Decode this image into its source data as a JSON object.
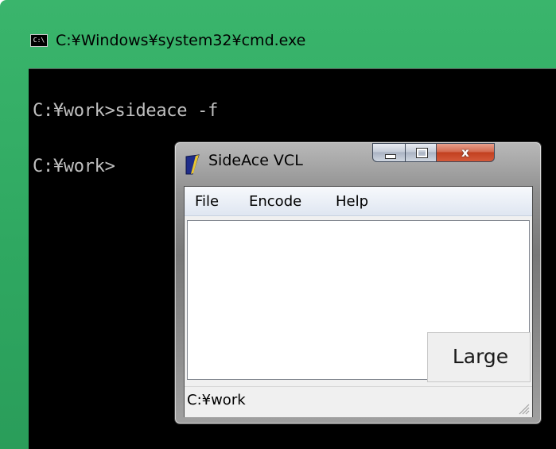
{
  "cmd": {
    "icon_text": "C:\\",
    "title": "C:¥Windows¥system32¥cmd.exe",
    "lines": [
      "C:¥work>sideace -f",
      "C:¥work>"
    ]
  },
  "app": {
    "title": "SideAce VCL",
    "controls": {
      "close_glyph": "x"
    },
    "menu": [
      "File",
      "Encode",
      "Help"
    ],
    "large_button": "Large",
    "status": "C:¥work"
  },
  "colors": {
    "cmd_frame": "#34ad66",
    "console_bg": "#000000",
    "console_text": "#c0c0c0",
    "close_button": "#c9492b"
  },
  "icons": {
    "cmd": "console-icon",
    "app": "sideace-app-icon",
    "grip": "resize-grip-icon"
  }
}
